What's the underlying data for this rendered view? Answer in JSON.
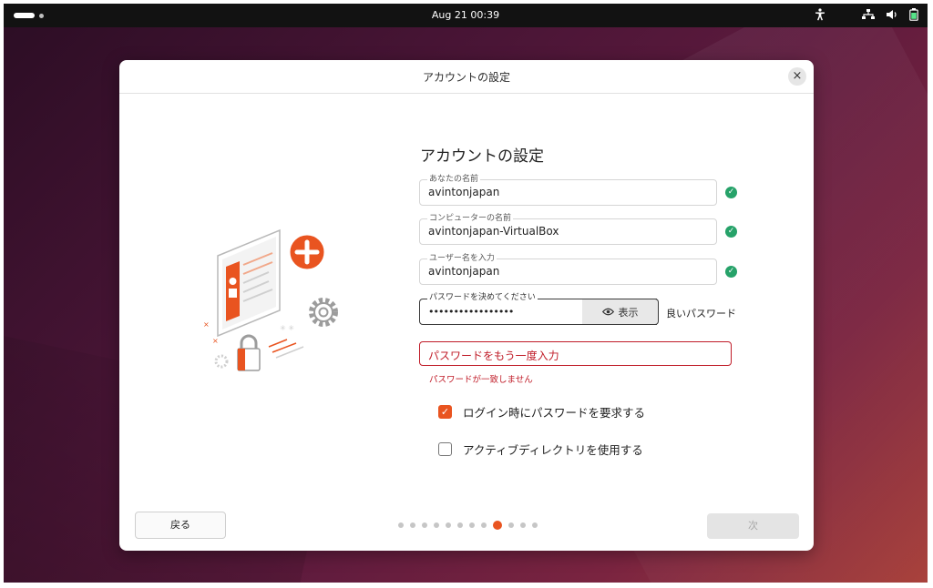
{
  "topbar": {
    "clock": "Aug 21  00:39",
    "icons": [
      "activities-pill",
      "workspace-dot",
      "accessibility-icon",
      "network-icon",
      "volume-icon",
      "battery-icon"
    ]
  },
  "dialog": {
    "title": "アカウントの設定",
    "close_icon": "×"
  },
  "form": {
    "heading": "アカウントの設定",
    "name": {
      "label": "あなたの名前",
      "value": "avintonjapan"
    },
    "computer": {
      "label": "コンピューターの名前",
      "value": "avintonjapan-VirtualBox"
    },
    "username": {
      "label": "ユーザー名を入力",
      "value": "avintonjapan"
    },
    "password": {
      "label": "パスワードを決めてください",
      "value": "•••••••••••••••••",
      "show_label": "表示",
      "strength": "良いパスワード"
    },
    "confirm": {
      "placeholder": "パスワードをもう一度入力",
      "error": "パスワードが一致しません"
    },
    "options": [
      {
        "label": "ログイン時にパスワードを要求する",
        "checked": true
      },
      {
        "label": "アクティブディレクトリを使用する",
        "checked": false
      }
    ]
  },
  "nav": {
    "back": "戻る",
    "next": "次",
    "step_total": 12,
    "step_current": 9
  },
  "colors": {
    "accent": "#e95420",
    "success": "#26a269",
    "error": "#c01c28"
  }
}
